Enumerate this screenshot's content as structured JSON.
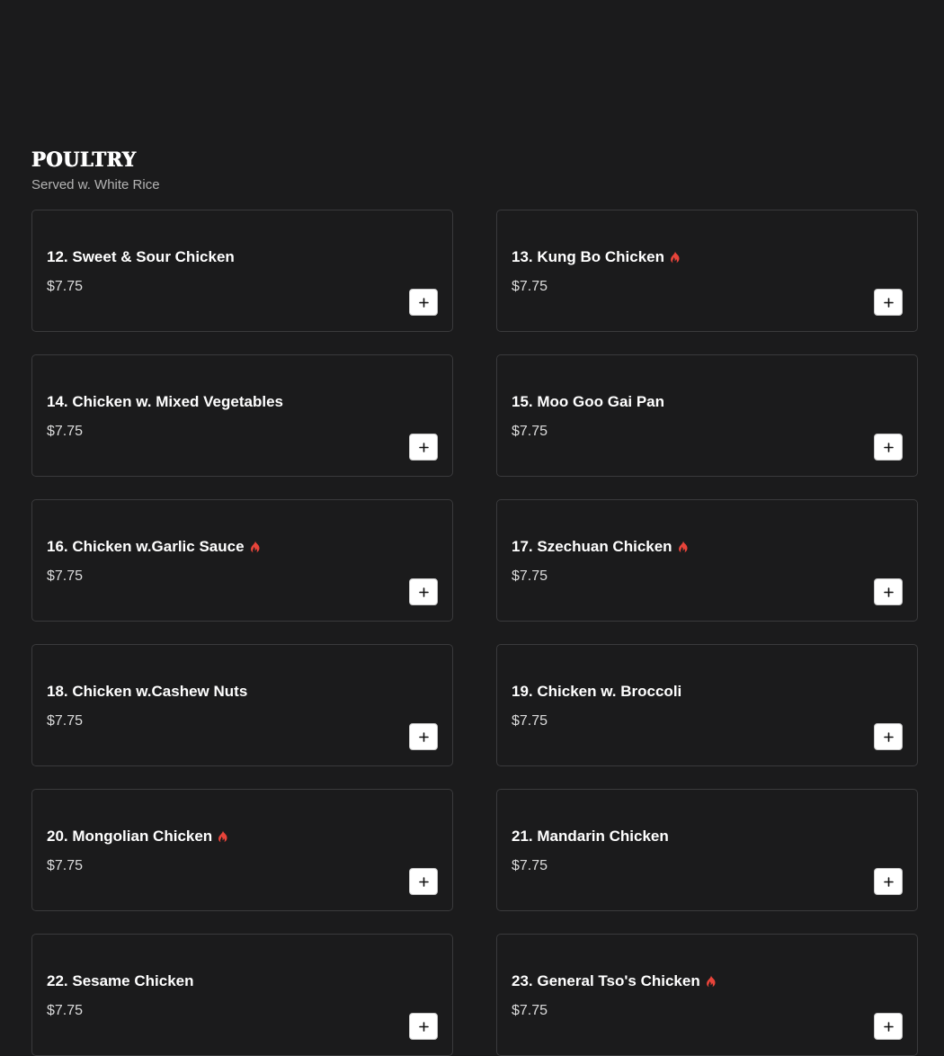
{
  "section": {
    "title": "POULTRY",
    "subtitle": "Served w. White Rice"
  },
  "colors": {
    "background": "#1b1b1c",
    "card_border": "#3a3a3c",
    "spicy": "#e8443a"
  },
  "items": [
    {
      "name": "12. Sweet & Sour Chicken",
      "price": "$7.75",
      "spicy": false
    },
    {
      "name": "13. Kung Bo Chicken",
      "price": "$7.75",
      "spicy": true
    },
    {
      "name": "14. Chicken w. Mixed Vegetables",
      "price": "$7.75",
      "spicy": false
    },
    {
      "name": "15. Moo Goo Gai Pan",
      "price": "$7.75",
      "spicy": false
    },
    {
      "name": "16. Chicken w.Garlic Sauce",
      "price": "$7.75",
      "spicy": true
    },
    {
      "name": "17. Szechuan Chicken",
      "price": "$7.75",
      "spicy": true
    },
    {
      "name": "18. Chicken w.Cashew Nuts",
      "price": "$7.75",
      "spicy": false
    },
    {
      "name": "19. Chicken w. Broccoli",
      "price": "$7.75",
      "spicy": false
    },
    {
      "name": "20. Mongolian Chicken",
      "price": "$7.75",
      "spicy": true
    },
    {
      "name": "21. Mandarin Chicken",
      "price": "$7.75",
      "spicy": false
    },
    {
      "name": "22. Sesame Chicken",
      "price": "$7.75",
      "spicy": false
    },
    {
      "name": "23. General Tso's Chicken",
      "price": "$7.75",
      "spicy": true
    }
  ],
  "icons": {
    "spicy": "flame-icon",
    "add": "plus-icon"
  }
}
